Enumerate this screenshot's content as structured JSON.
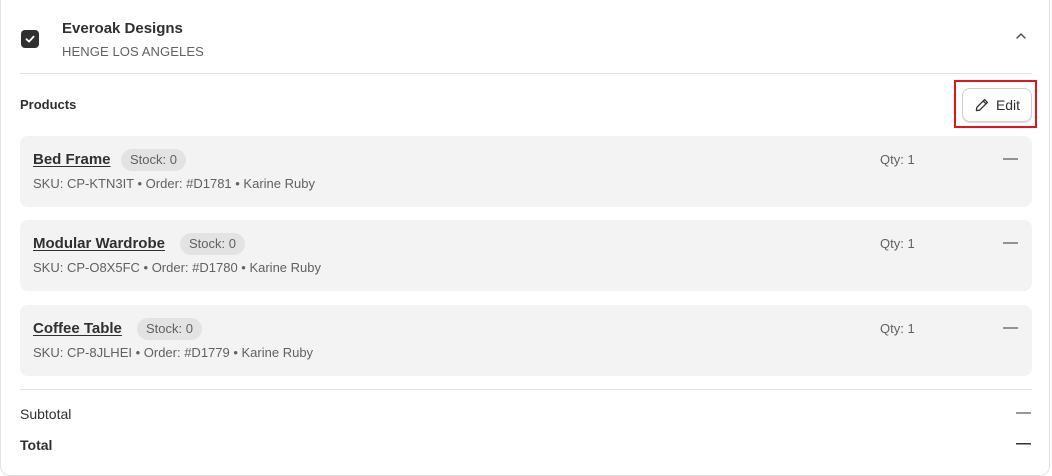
{
  "vendor": {
    "name": "Everoak Designs",
    "location": "HENGE LOS ANGELES",
    "checked": true
  },
  "products_section": {
    "title": "Products",
    "edit_label": "Edit"
  },
  "products": [
    {
      "name": "Bed Frame",
      "stock": "Stock: 0",
      "meta": "SKU: CP-KTN3IT • Order: #D1781 • Karine Ruby",
      "qty": "Qty: 1",
      "dash": "—"
    },
    {
      "name": "Modular Wardrobe",
      "stock": "Stock: 0",
      "meta": "SKU: CP-O8X5FC • Order: #D1780 • Karine Ruby",
      "qty": "Qty: 1",
      "dash": "—"
    },
    {
      "name": "Coffee Table",
      "stock": "Stock: 0",
      "meta": "SKU: CP-8JLHEI • Order: #D1779 • Karine Ruby",
      "qty": "Qty: 1",
      "dash": "—"
    }
  ],
  "summary": {
    "subtotal_label": "Subtotal",
    "subtotal_value": "—",
    "total_label": "Total",
    "total_value": "—"
  },
  "colors": {
    "highlight": "#e3141e",
    "row_background": "#f3f3f3"
  }
}
